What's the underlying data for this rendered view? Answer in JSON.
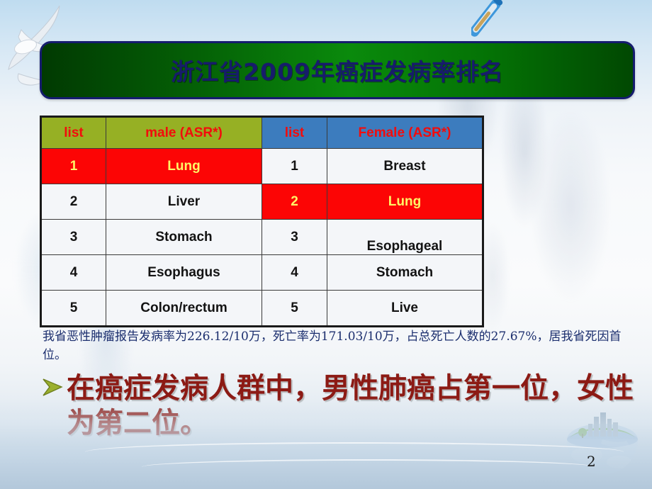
{
  "slide": {
    "title": "浙江省2009年癌症发病率排名",
    "page_number": "2",
    "colors": {
      "title_box_green": "#0a8a0c",
      "title_text_navy": "#171C6B",
      "header_olive": "#96B024",
      "header_blue": "#3C7CBE",
      "highlight_red": "#FC0505",
      "highlight_text_yellow": "#FFF566",
      "paragraph_navy": "#1B2E6E",
      "bullet_dark_red": "#8C1A14",
      "bullet_arrow_green": "#8FA832"
    }
  },
  "table": {
    "headers": [
      {
        "label": "list",
        "style": "olive"
      },
      {
        "label": "male (ASR*)",
        "style": "olive"
      },
      {
        "label": "list",
        "style": "blue"
      },
      {
        "label": "Female (ASR*)",
        "style": "blue"
      }
    ],
    "rows": [
      {
        "male_rank": "1",
        "male_site": "Lung",
        "male_highlight": true,
        "female_rank": "1",
        "female_site": "Breast",
        "female_highlight": false
      },
      {
        "male_rank": "2",
        "male_site": "Liver",
        "male_highlight": false,
        "female_rank": "2",
        "female_site": "Lung",
        "female_highlight": true
      },
      {
        "male_rank": "3",
        "male_site": "Stomach",
        "male_highlight": false,
        "female_rank": "3",
        "female_site": "Esophageal",
        "female_highlight": false
      },
      {
        "male_rank": "4",
        "male_site": "Esophagus",
        "male_highlight": false,
        "female_rank": "4",
        "female_site": "Stomach",
        "female_highlight": false
      },
      {
        "male_rank": "5",
        "male_site": "Colon/rectum",
        "male_highlight": false,
        "female_rank": "5",
        "female_site": "Live",
        "female_highlight": false
      }
    ]
  },
  "body": {
    "paragraph": "我省恶性肿瘤报告发病率为226.12/10万，死亡率为171.03/10万，占总死亡人数的27.67%，居我省死因首位。",
    "bullet_text": "在癌症发病人群中，男性肺癌占第一位，女性为第二位。",
    "bullet_marker": "➢"
  },
  "decorations": {
    "seagull": "seagull-icon",
    "thermometer": "thermometer-icon",
    "globe_city": "globe-city-icon"
  }
}
